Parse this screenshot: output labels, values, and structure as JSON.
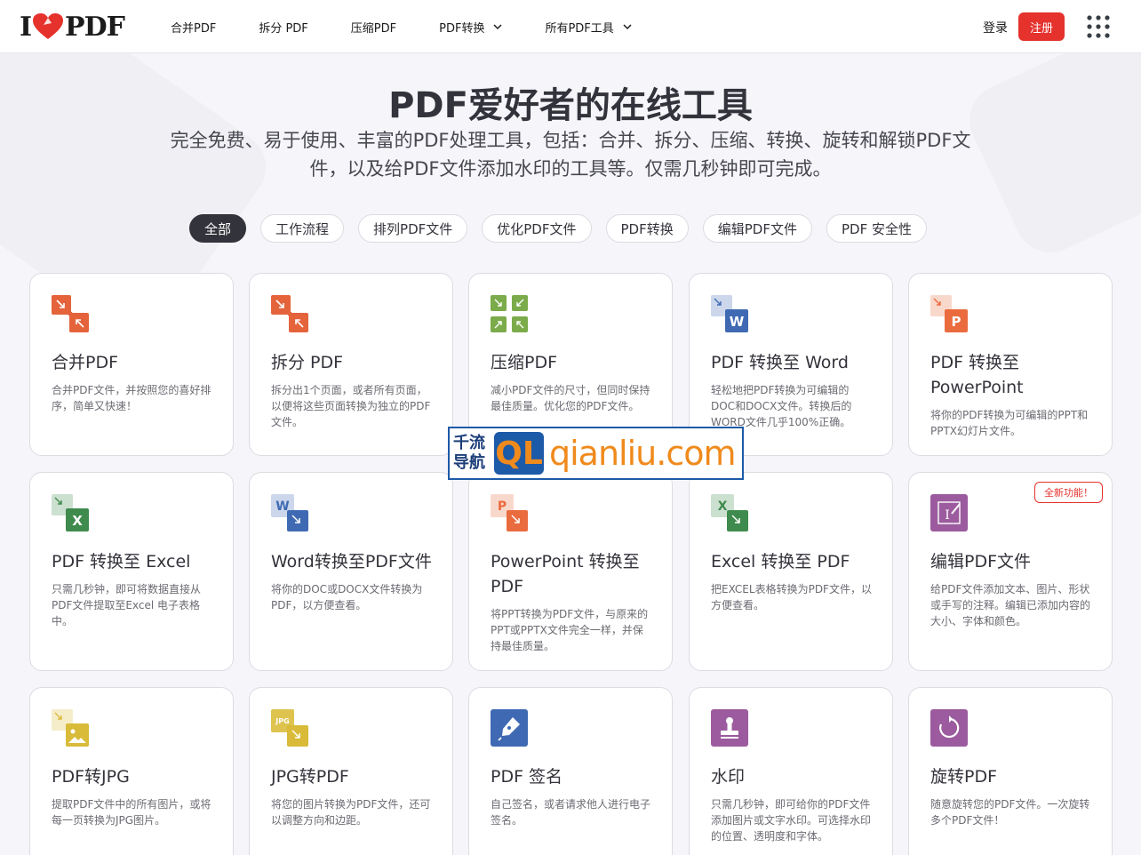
{
  "header": {
    "logo_left": "I",
    "logo_right": "PDF",
    "nav": [
      {
        "label": "合并PDF",
        "dropdown": false
      },
      {
        "label": "拆分 PDF",
        "dropdown": false
      },
      {
        "label": "压缩PDF",
        "dropdown": false
      },
      {
        "label": "PDF转换",
        "dropdown": true
      },
      {
        "label": "所有PDF工具",
        "dropdown": true
      }
    ],
    "login": "登录",
    "signup": "注册"
  },
  "hero": {
    "title": "PDF爱好者的在线工具",
    "subtitle_line1": "完全免费、易于使用、丰富的PDF处理工具，包括：合并、拆分、压缩、转换、旋转和解锁PDF文",
    "subtitle_line2": "件，以及给PDF文件添加水印的工具等。仅需几秒钟即可完成。"
  },
  "filters": [
    "全部",
    "工作流程",
    "排列PDF文件",
    "优化PDF文件",
    "PDF转换",
    "编辑PDF文件",
    "PDF 安全性"
  ],
  "tools": [
    {
      "title": "合并PDF",
      "desc": "合并PDF文件，并按照您的喜好排序，简单又快速！",
      "icon": "merge-icon",
      "color": "#e5633b"
    },
    {
      "title": "拆分 PDF",
      "desc": "拆分出1个页面，或者所有页面，以便将这些页面转换为独立的PDF文件。",
      "icon": "split-icon",
      "color": "#e5633b"
    },
    {
      "title": "压缩PDF",
      "desc": "减小PDF文件的尺寸，但同时保持最佳质量。优化您的PDF文件。",
      "icon": "compress-icon",
      "color": "#7bab4a"
    },
    {
      "title": "PDF 转换至 Word",
      "desc": "轻松地把PDF转换为可编辑的DOC和DOCX文件。转换后的WORD文件几乎100%正确。",
      "icon": "pdf-to-word-icon",
      "color": "#3f6ab3"
    },
    {
      "title": "PDF 转换至 PowerPoint",
      "desc": "将你的PDF转换为可编辑的PPT和PPTX幻灯片文件。",
      "icon": "pdf-to-ppt-icon",
      "color": "#ea6b3e"
    },
    {
      "title": "PDF 转换至 Excel",
      "desc": "只需几秒钟，即可将数据直接从PDF文件提取至Excel 电子表格中。",
      "icon": "pdf-to-excel-icon",
      "color": "#3f8a4d"
    },
    {
      "title": "Word转换至PDF文件",
      "desc": "将你的DOC或DOCX文件转换为PDF，以方便查看。",
      "icon": "word-to-pdf-icon",
      "color": "#3f6ab3"
    },
    {
      "title": "PowerPoint 转换至 PDF",
      "desc": "将PPT转换为PDF文件，与原来的PPT或PPTX文件完全一样，并保持最佳质量。",
      "icon": "ppt-to-pdf-icon",
      "color": "#ea6b3e"
    },
    {
      "title": "Excel 转换至 PDF",
      "desc": "把EXCEL表格转换为PDF文件，以方便查看。",
      "icon": "excel-to-pdf-icon",
      "color": "#3f8a4d"
    },
    {
      "title": "编辑PDF文件",
      "desc": "给PDF文件添加文本、图片、形状或手写的注释。编辑已添加内容的大小、字体和颜色。",
      "icon": "edit-pdf-icon",
      "color": "#9b5b9e",
      "badge": "全新功能！"
    },
    {
      "title": "PDF转JPG",
      "desc": "提取PDF文件中的所有图片，或将每一页转换为JPG图片。",
      "icon": "pdf-to-jpg-icon",
      "color": "#d9bb39"
    },
    {
      "title": "JPG转PDF",
      "desc": "将您的图片转换为PDF文件，还可以调整方向和边距。",
      "icon": "jpg-to-pdf-icon",
      "color": "#d9bb39",
      "icon_text": "JPG"
    },
    {
      "title": "PDF 签名",
      "desc": "自己签名，或者请求他人进行电子签名。",
      "icon": "sign-pen-icon",
      "color": "#3f6ab3"
    },
    {
      "title": "水印",
      "desc": "只需几秒钟，即可给你的PDF文件添加图片或文字水印。可选择水印的位置、透明度和字体。",
      "icon": "watermark-stamp-icon",
      "color": "#9b5b9e"
    },
    {
      "title": "旋转PDF",
      "desc": "随意旋转您的PDF文件。一次旋转多个PDF文件！",
      "icon": "rotate-icon",
      "color": "#9b5b9e"
    }
  ],
  "watermark": {
    "cn_line1": "千流",
    "cn_line2": "导航",
    "badge": "QL",
    "domain": "qianliu.com"
  }
}
